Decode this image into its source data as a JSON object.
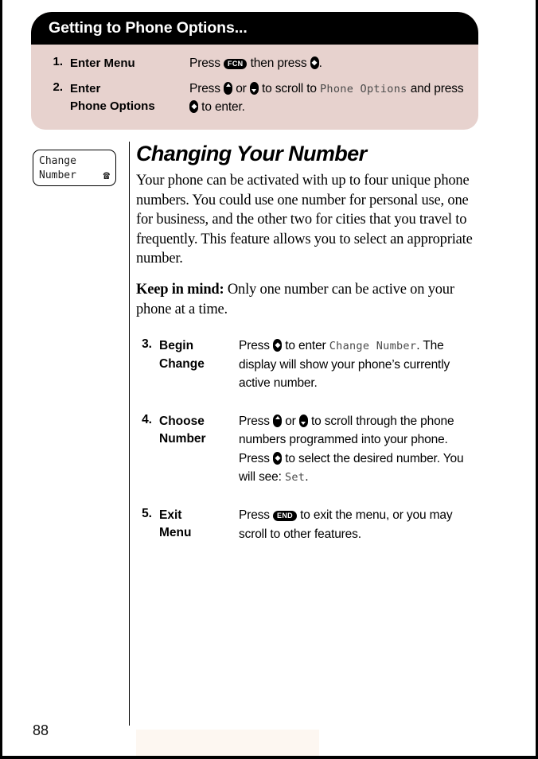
{
  "callout": {
    "header": "Getting to Phone Options...",
    "steps": [
      {
        "num": "1.",
        "title": "Enter Menu",
        "parts": [
          {
            "t": "text",
            "v": "Press "
          },
          {
            "t": "pill",
            "v": "FCN"
          },
          {
            "t": "text",
            "v": " then press "
          },
          {
            "t": "key-select",
            "v": ""
          },
          {
            "t": "text",
            "v": "."
          }
        ]
      },
      {
        "num": "2.",
        "title": "Enter\nPhone Options",
        "parts": [
          {
            "t": "text",
            "v": "Press "
          },
          {
            "t": "key-up",
            "v": ""
          },
          {
            "t": "text",
            "v": " or "
          },
          {
            "t": "key-down",
            "v": ""
          },
          {
            "t": "text",
            "v": " to scroll to "
          },
          {
            "t": "lcd",
            "v": "Phone Options"
          },
          {
            "t": "text",
            "v": " and press "
          },
          {
            "t": "key-select",
            "v": ""
          },
          {
            "t": "text",
            "v": " to enter."
          }
        ]
      }
    ]
  },
  "sidebar": {
    "lcd_line1": "Change",
    "lcd_line2": "Number",
    "phone_icon": "☎"
  },
  "main": {
    "title": "Changing Your Number",
    "paragraph1": "Your phone can be activated with up to four unique phone numbers. You could use one number for personal use, one for business, and the other two for cities that you travel to frequently. This feature allows you to select an appropriate number.",
    "keep_in_mind_label": "Keep in mind:",
    "keep_in_mind_text": " Only one number can be active on your phone at a time.",
    "steps": [
      {
        "num": "3.",
        "title": "Begin\nChange",
        "parts": [
          {
            "t": "text",
            "v": "Press "
          },
          {
            "t": "key-select",
            "v": ""
          },
          {
            "t": "text",
            "v": " to enter "
          },
          {
            "t": "lcd",
            "v": "Change Number"
          },
          {
            "t": "text",
            "v": ". The display will show your phone’s currently active number."
          }
        ]
      },
      {
        "num": "4.",
        "title": "Choose\nNumber",
        "parts": [
          {
            "t": "text",
            "v": "Press "
          },
          {
            "t": "key-up",
            "v": ""
          },
          {
            "t": "text",
            "v": " or "
          },
          {
            "t": "key-down",
            "v": ""
          },
          {
            "t": "text",
            "v": " to scroll through the phone numbers programmed into your phone. Press "
          },
          {
            "t": "key-select",
            "v": ""
          },
          {
            "t": "text",
            "v": " to select the desired number. You will see: "
          },
          {
            "t": "lcd",
            "v": "Set"
          },
          {
            "t": "text",
            "v": "."
          }
        ]
      },
      {
        "num": "5.",
        "title": "Exit\nMenu",
        "parts": [
          {
            "t": "text",
            "v": "Press "
          },
          {
            "t": "pill",
            "v": "END"
          },
          {
            "t": "text",
            "v": " to exit the menu, or you may scroll to other features."
          }
        ]
      }
    ]
  },
  "footer": {
    "page_number": "88"
  },
  "colors": {
    "callout_header_bg": "#000000",
    "callout_body_bg": "#e7d2ce",
    "footer_bar": "#fdf7f1",
    "page_bg": "#ffffff"
  }
}
